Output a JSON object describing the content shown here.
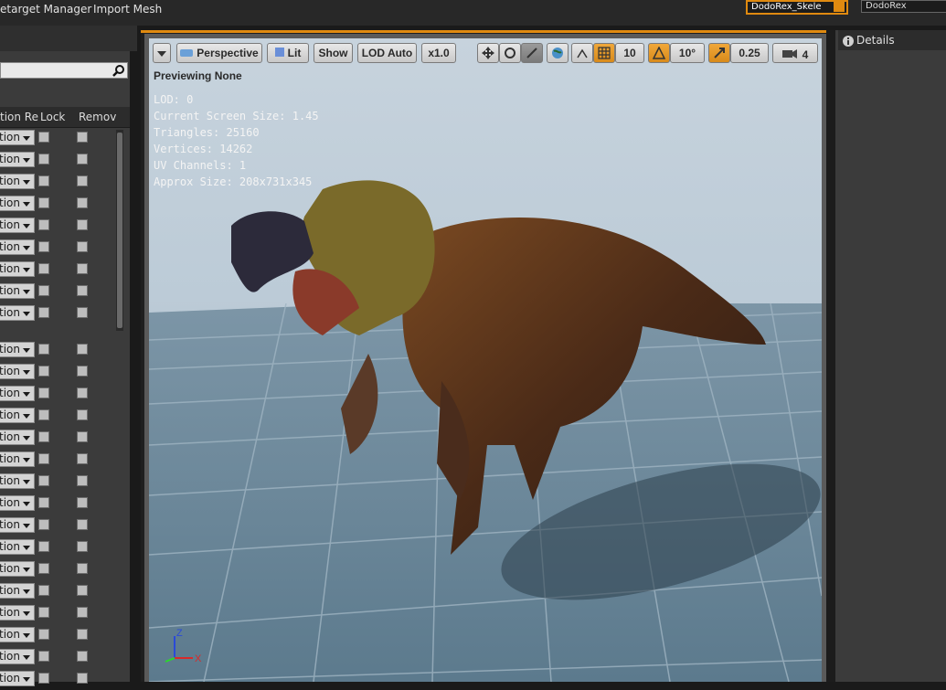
{
  "top_toolbar": {
    "retarget_label": "etarget Manager",
    "import_label": "Import Mesh",
    "skeleton_combo": "DodoRex_Skele",
    "mesh_combo": "DodoRex"
  },
  "left_panel": {
    "columns": [
      "tion Re",
      "Lock",
      "Remov"
    ],
    "row_option": "tion",
    "row_count": 25
  },
  "viewport": {
    "perspective_label": "Perspective",
    "lit_label": "Lit",
    "show_label": "Show",
    "lod_label": "LOD Auto",
    "speed_label": "x1.0",
    "grid_snap": "10",
    "rot_snap": "10°",
    "scale_snap": "0.25",
    "camera_speed": "4",
    "previewing": "Previewing None",
    "stats": {
      "lod": "LOD: 0",
      "screen_size": "Current Screen Size: 1.45",
      "triangles": "Triangles: 25160",
      "vertices": "Vertices: 14262",
      "uv_channels": "UV Channels: 1",
      "approx_size": "Approx Size: 208x731x345"
    },
    "axis_z": "Z",
    "axis_x": "X"
  },
  "details_panel": {
    "title": "Details"
  },
  "colors": {
    "accent": "#e08a10",
    "panel": "#3b3b3b"
  }
}
